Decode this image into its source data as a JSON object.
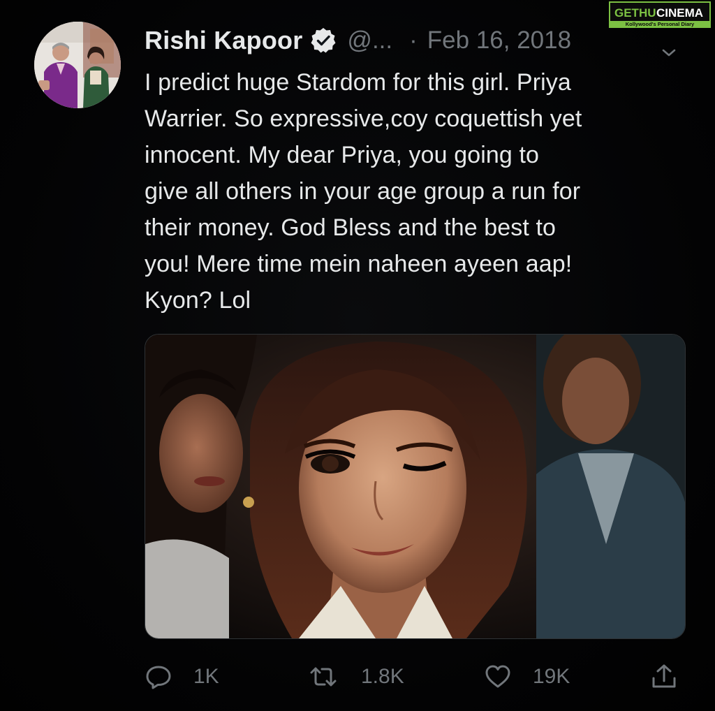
{
  "tweet": {
    "author": {
      "display_name": "Rishi Kapoor",
      "handle": "@...",
      "verified_icon": "verified-badge-icon"
    },
    "separator": "·",
    "date": "Feb 16, 2018",
    "text_lines": [
      "I predict huge Stardom for this girl. Priya",
      "Warrier. So expressive,coy coquettish yet",
      "innocent. My dear Priya, you going to",
      "give all others in your age group a run for",
      "their money. God Bless and the best to",
      "you! Mere time mein naheen ayeen aap!",
      "Kyon? Lol"
    ],
    "media_description": "photo",
    "actions": {
      "reply": {
        "icon": "reply-icon",
        "count": "1K"
      },
      "retweet": {
        "icon": "retweet-icon",
        "count": "1.8K"
      },
      "like": {
        "icon": "heart-icon",
        "count": "19K"
      },
      "share": {
        "icon": "share-icon"
      }
    }
  },
  "watermark": {
    "text_left": "GETHU",
    "text_right": "CINEMA",
    "tagline": "Kollywood's Personal Diary"
  },
  "colors": {
    "background": "#020203",
    "text_primary": "#e7e9ea",
    "text_secondary": "#71767b",
    "watermark_green": "#7cc143"
  }
}
